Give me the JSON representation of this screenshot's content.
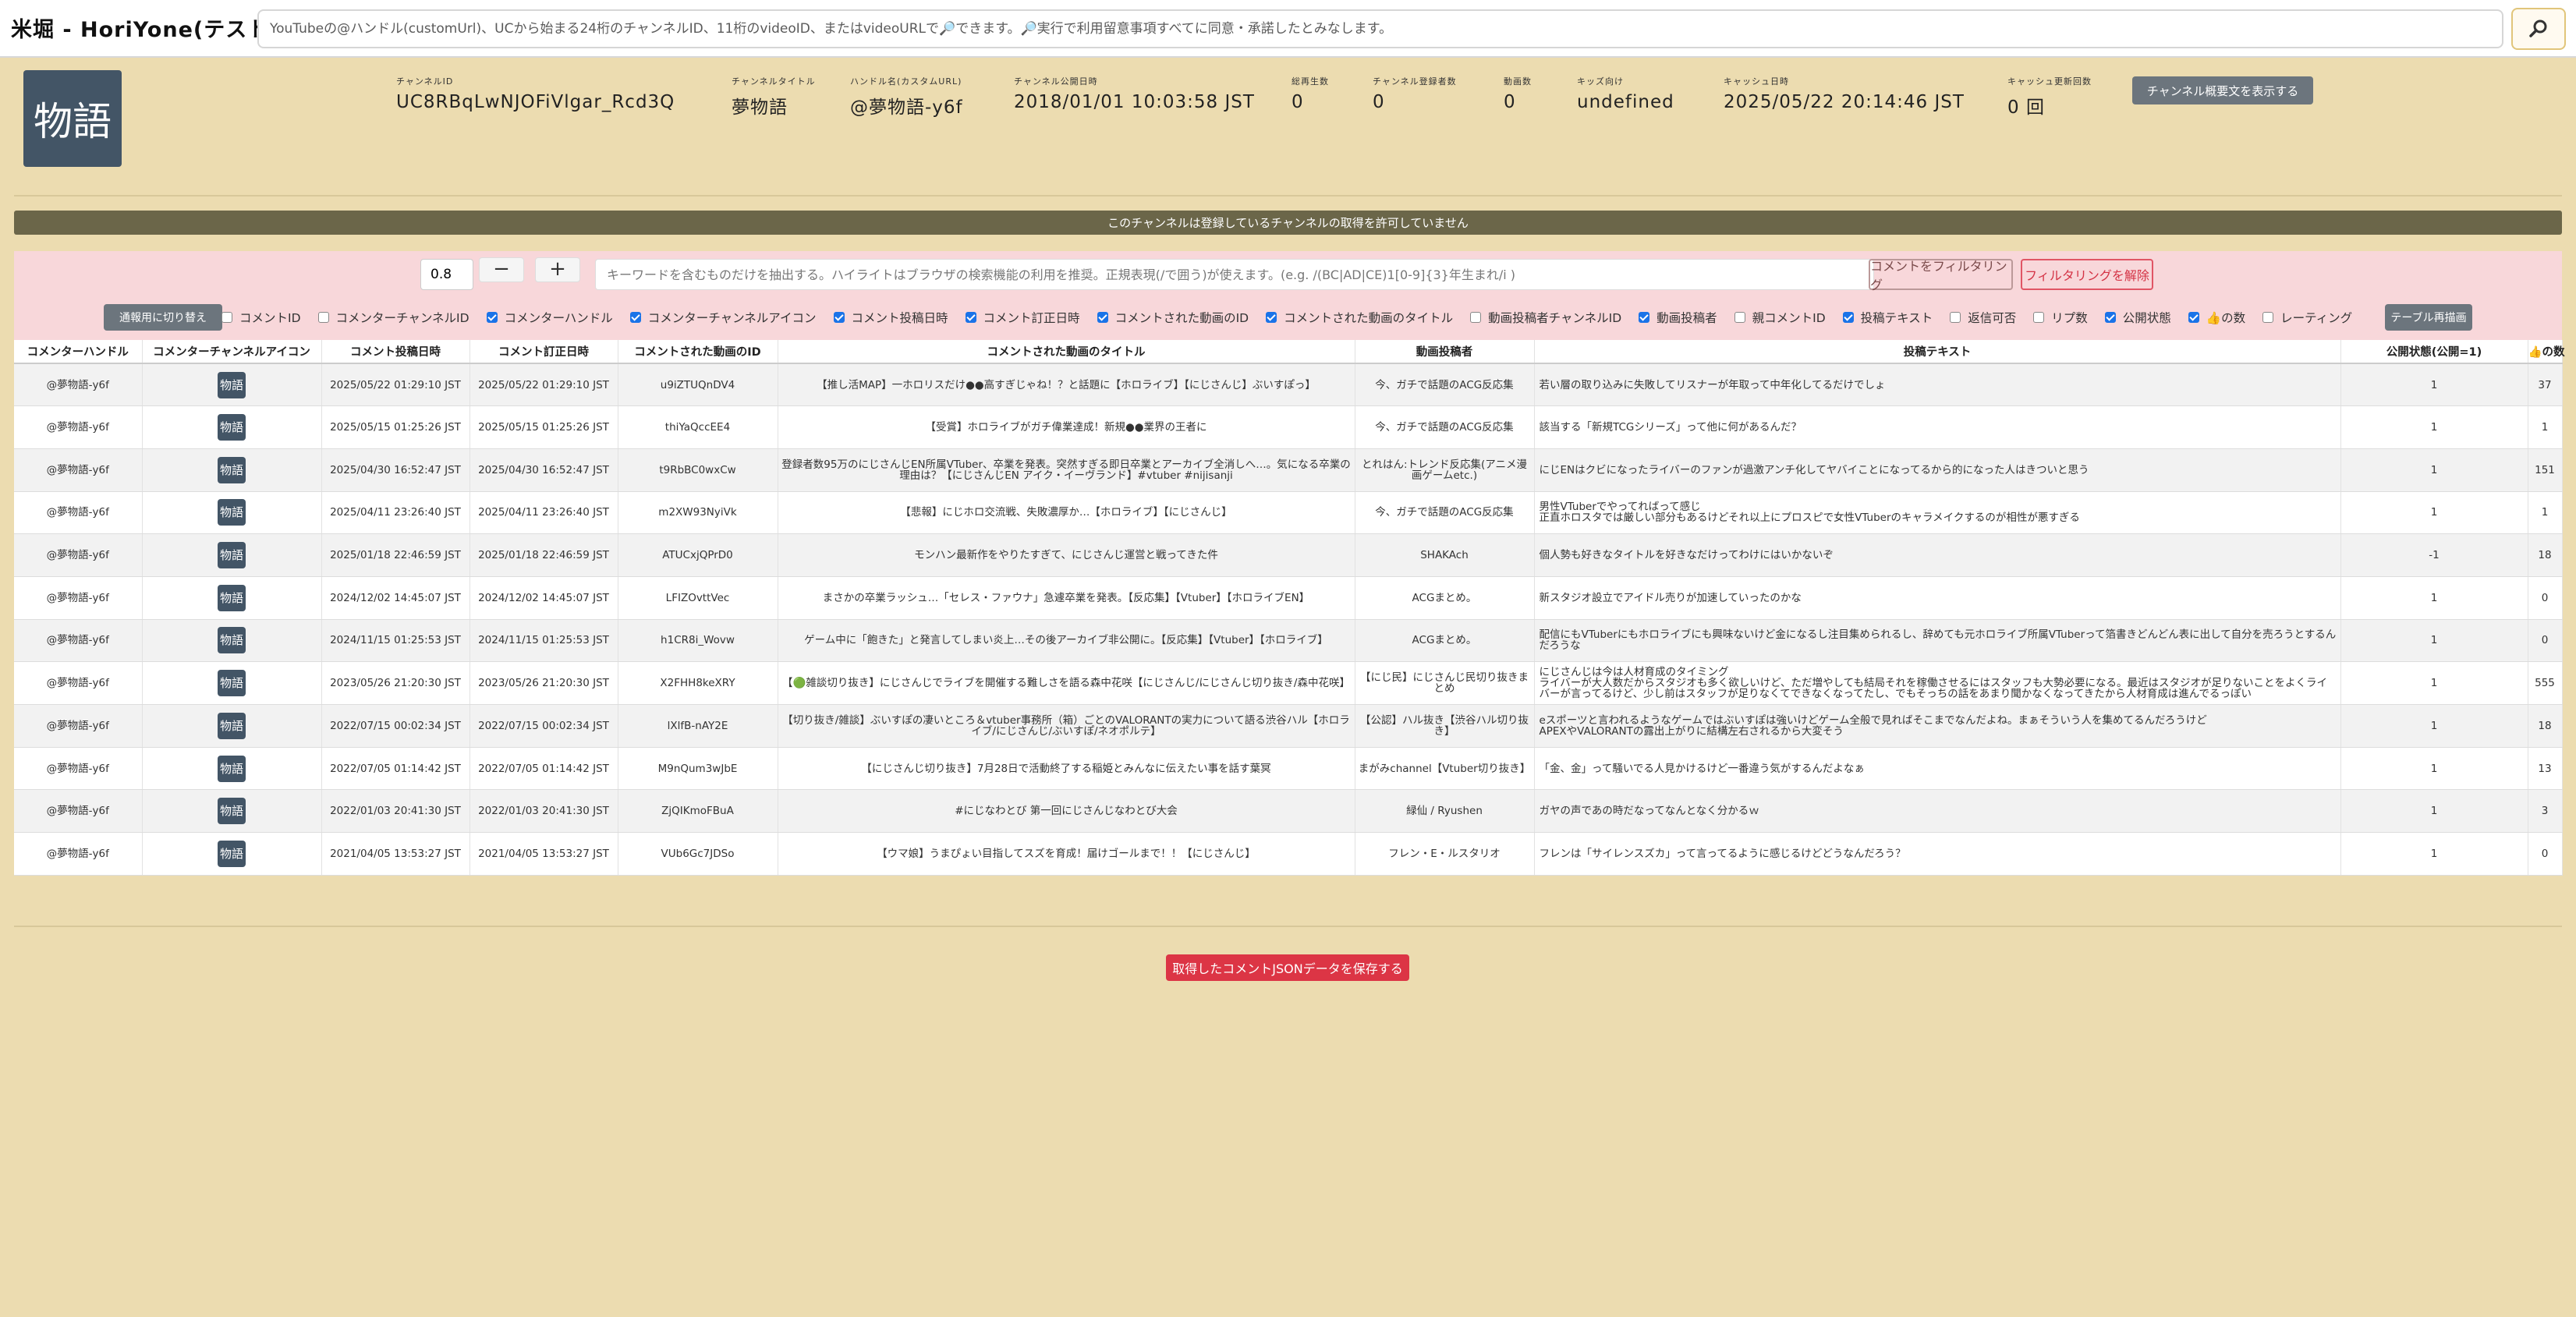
{
  "app": {
    "title": "米堀 - HoriYone(テスト中)",
    "search_placeholder": "YouTubeの@ハンドル(customUrl)、UCから始まる24桁のチャンネルID、11桁のvideoID、またはvideoURLで🔎できます。🔎実行で利用留意事項すべてに同意・承諾したとみなします。",
    "search_button_icon": "search-icon"
  },
  "channel": {
    "avatar_text": "物語",
    "fields": [
      {
        "label": "チャンネルID",
        "value": "UC8RBqLwNJOFiVlgar_Rcd3Q"
      },
      {
        "label": "チャンネルタイトル",
        "value": "夢物語"
      },
      {
        "label": "ハンドル名(カスタムURL)",
        "value": "@夢物語-y6f"
      },
      {
        "label": "チャンネル公開日時",
        "value": "2018/01/01 10:03:58 JST"
      },
      {
        "label": "総再生数",
        "value": "0"
      },
      {
        "label": "チャンネル登録者数",
        "value": "0"
      },
      {
        "label": "動画数",
        "value": "0"
      },
      {
        "label": "キッズ向け",
        "value": "undefined"
      },
      {
        "label": "キャッシュ日時",
        "value": "2025/05/22 20:14:46 JST"
      },
      {
        "label": "キャッシュ更新回数",
        "value": "0 回"
      }
    ],
    "desc_button": "チャンネル概要文を表示する"
  },
  "notice": "このチャンネルは登録しているチャンネルの取得を許可していません",
  "filter": {
    "step_value": "0.8",
    "minus": "−",
    "plus": "+",
    "keyword_placeholder": "キーワードを含むものだけを抽出する。ハイライトはブラウザの検索機能の利用を推奨。正規表現(/で囲う)が使えます。(e.g. /(BC|AD|CE)1[0-9]{3}年生まれ/i )",
    "filter_button": "コメントをフィルタリング",
    "clear_button": "フィルタリングを解除",
    "toggle_button": "通報用に切り替え",
    "redraw_button": "テーブル再描画",
    "checkboxes": [
      {
        "label": "コメントID",
        "checked": false
      },
      {
        "label": "コメンターチャンネルID",
        "checked": false
      },
      {
        "label": "コメンターハンドル",
        "checked": true
      },
      {
        "label": "コメンターチャンネルアイコン",
        "checked": true
      },
      {
        "label": "コメント投稿日時",
        "checked": true
      },
      {
        "label": "コメント訂正日時",
        "checked": true
      },
      {
        "label": "コメントされた動画のID",
        "checked": true
      },
      {
        "label": "コメントされた動画のタイトル",
        "checked": true
      },
      {
        "label": "動画投稿者チャンネルID",
        "checked": false
      },
      {
        "label": "動画投稿者",
        "checked": true
      },
      {
        "label": "親コメントID",
        "checked": false
      },
      {
        "label": "投稿テキスト",
        "checked": true
      },
      {
        "label": "返信可否",
        "checked": false
      },
      {
        "label": "リプ数",
        "checked": false
      },
      {
        "label": "公開状態",
        "checked": true
      },
      {
        "label": "👍の数",
        "checked": true
      },
      {
        "label": "レーティング",
        "checked": false
      }
    ]
  },
  "table": {
    "headers": [
      "コメンターハンドル",
      "コメンターチャンネルアイコン",
      "コメント投稿日時",
      "コメント訂正日時",
      "コメントされた動画のID",
      "コメントされた動画のタイトル",
      "動画投稿者",
      "投稿テキスト",
      "公開状態(公開=1)",
      "👍の数"
    ],
    "rows": [
      {
        "handle": "@夢物語-y6f",
        "icon": "物語",
        "posted": "2025/05/22 01:29:10 JST",
        "edited": "2025/05/22 01:29:10 JST",
        "video_id": "u9iZTUQnDV4",
        "video_title": "【推し活MAP】一ホロリスだけ●●高すぎじゃね！？と話題に【ホロライブ】【にじさんじ】ぶいすぽっ】",
        "uploader": "今、ガチで話題のACG反応集",
        "text": "若い層の取り込みに失敗してリスナーが年取って中年化してるだけでしょ",
        "public": "1",
        "likes": "37"
      },
      {
        "handle": "@夢物語-y6f",
        "icon": "物語",
        "posted": "2025/05/15 01:25:26 JST",
        "edited": "2025/05/15 01:25:26 JST",
        "video_id": "thiYaQccEE4",
        "video_title": "【受賞】ホロライブがガチ偉業達成！新規●●業界の王者に",
        "uploader": "今、ガチで話題のACG反応集",
        "text": "該当する「新規TCGシリーズ」って他に何があるんだ？",
        "public": "1",
        "likes": "1"
      },
      {
        "handle": "@夢物語-y6f",
        "icon": "物語",
        "posted": "2025/04/30 16:52:47 JST",
        "edited": "2025/04/30 16:52:47 JST",
        "video_id": "t9RbBC0wxCw",
        "video_title": "登録者数95万のにじさんじEN所属VTuber、卒業を発表。突然すぎる即日卒業とアーカイブ全消しへ…。気になる卒業の理由は？【にじさんじEN アイク・イーヴランド】#vtuber #nijisanji",
        "uploader": "とれはん:トレンド反応集(アニメ漫画ゲームetc.)",
        "text": "にじENはクビになったライバーのファンが過激アンチ化してヤバイことになってるから的になった人はきついと思う",
        "public": "1",
        "likes": "151"
      },
      {
        "handle": "@夢物語-y6f",
        "icon": "物語",
        "posted": "2025/04/11 23:26:40 JST",
        "edited": "2025/04/11 23:26:40 JST",
        "video_id": "m2XW93NyiVk",
        "video_title": "【悲報】にじホロ交流戦、失敗濃厚か…【ホロライブ】【にじさんじ】",
        "uploader": "今、ガチで話題のACG反応集",
        "text": "男性VTuberでやってればって感じ\n正直ホロスタでは厳しい部分もあるけどそれ以上にプロスピで女性VTuberのキャラメイクするのが相性が悪すぎる",
        "public": "1",
        "likes": "1"
      },
      {
        "handle": "@夢物語-y6f",
        "icon": "物語",
        "posted": "2025/01/18 22:46:59 JST",
        "edited": "2025/01/18 22:46:59 JST",
        "video_id": "ATUCxjQPrD0",
        "video_title": "モンハン最新作をやりたすぎて、にじさんじ運営と戦ってきた件",
        "uploader": "SHAKAch",
        "text": "個人勢も好きなタイトルを好きなだけってわけにはいかないぞ",
        "public": "-1",
        "likes": "18"
      },
      {
        "handle": "@夢物語-y6f",
        "icon": "物語",
        "posted": "2024/12/02 14:45:07 JST",
        "edited": "2024/12/02 14:45:07 JST",
        "video_id": "LFIZOvttVec",
        "video_title": "まさかの卒業ラッシュ…「セレス・ファウナ」急遽卒業を発表。【反応集】【Vtuber】【ホロライブEN】",
        "uploader": "ACGまとめ。",
        "text": "新スタジオ設立でアイドル売りが加速していったのかな",
        "public": "1",
        "likes": "0"
      },
      {
        "handle": "@夢物語-y6f",
        "icon": "物語",
        "posted": "2024/11/15 01:25:53 JST",
        "edited": "2024/11/15 01:25:53 JST",
        "video_id": "h1CR8i_Wovw",
        "video_title": "ゲーム中に「飽きた」と発言してしまい炎上…その後アーカイブ非公開に。【反応集】【Vtuber】【ホロライブ】",
        "uploader": "ACGまとめ。",
        "text": "配信にもVTuberにもホロライブにも興味ないけど金になるし注目集められるし、辞めても元ホロライブ所属VTuberって箔書きどんどん表に出して自分を売ろうとするんだろうな",
        "public": "1",
        "likes": "0"
      },
      {
        "handle": "@夢物語-y6f",
        "icon": "物語",
        "posted": "2023/05/26 21:20:30 JST",
        "edited": "2023/05/26 21:20:30 JST",
        "video_id": "X2FHH8keXRY",
        "video_title": "【🟢雑談切り抜き】にじさんじでライブを開催する難しさを語る森中花咲【にじさんじ/にじさんじ切り抜き/森中花咲】",
        "uploader": "【にじ民】にじさんじ民切り抜きまとめ",
        "text": "にじさんじは今は人材育成のタイミング\nライバーが大人数だからスタジオも多く欲しいけど、ただ増やしても結局それを稼働させるにはスタッフも大勢必要になる。最近はスタジオが足りないことをよくライバーが言ってるけど、少し前はスタッフが足りなくてできなくなってたし、でもそっちの話をあまり聞かなくなってきたから人材育成は進んでるっぽい",
        "public": "1",
        "likes": "555"
      },
      {
        "handle": "@夢物語-y6f",
        "icon": "物語",
        "posted": "2022/07/15 00:02:34 JST",
        "edited": "2022/07/15 00:02:34 JST",
        "video_id": "lXlfB-nAY2E",
        "video_title": "【切り抜き/雑談】ぶいすぽの凄いところ＆vtuber事務所（箱）ごとのVALORANTの実力について語る渋谷ハル【ホロライブ/にじさんじ/ぶいすぽ/ネオポルテ】",
        "uploader": "【公認】ハル抜き【渋谷ハル切り抜き】",
        "text": "eスポーツと言われるようなゲームではぶいすぽは強いけどゲーム全般で見ればそこまでなんだよね。まぁそういう人を集めてるんだろうけど\nAPEXやVALORANTの露出上がりに結構左右されるから大変そう",
        "public": "1",
        "likes": "18"
      },
      {
        "handle": "@夢物語-y6f",
        "icon": "物語",
        "posted": "2022/07/05 01:14:42 JST",
        "edited": "2022/07/05 01:14:42 JST",
        "video_id": "M9nQum3wJbE",
        "video_title": "【にじさんじ切り抜き】7月28日で活動終了する稲姫とみんなに伝えたい事を話す葉冥",
        "uploader": "まがみchannel【Vtuber切り抜き】",
        "text": "「金、金」って騒いでる人見かけるけど一番違う気がするんだよなぁ",
        "public": "1",
        "likes": "13"
      },
      {
        "handle": "@夢物語-y6f",
        "icon": "物語",
        "posted": "2022/01/03 20:41:30 JST",
        "edited": "2022/01/03 20:41:30 JST",
        "video_id": "ZjQIKmoFBuA",
        "video_title": "#にじなわとび 第一回にじさんじなわとび大会",
        "uploader": "緑仙 / Ryushen",
        "text": "ガヤの声であの時だなってなんとなく分かるｗ",
        "public": "1",
        "likes": "3"
      },
      {
        "handle": "@夢物語-y6f",
        "icon": "物語",
        "posted": "2021/04/05 13:53:27 JST",
        "edited": "2021/04/05 13:53:27 JST",
        "video_id": "VUb6Gc7JDSo",
        "video_title": "【ウマ娘】うまぴょい目指してスズを育成！届けゴールまで！！【にじさんじ】",
        "uploader": "フレン・E・ルスタリオ",
        "text": "フレンは「サイレンスズカ」って言ってるように感じるけどどうなんだろう？",
        "public": "1",
        "likes": "0"
      }
    ]
  },
  "save_button": "取得したコメントJSONデータを保存する",
  "colors": {
    "background": "#ecdcb0",
    "avatar": "#435566",
    "notice_bar": "#6b6649",
    "panel": "#f8d7da",
    "danger": "#dc3545",
    "checkbox_on": "#1a73e8"
  }
}
